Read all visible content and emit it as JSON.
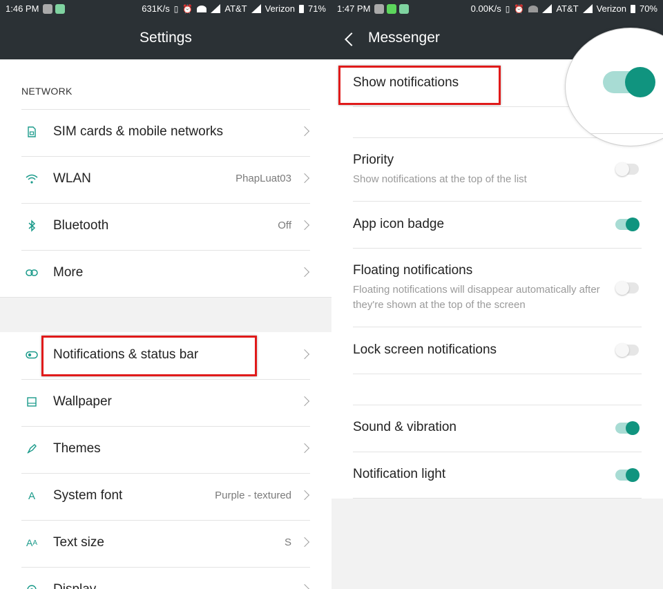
{
  "left": {
    "status": {
      "time": "1:46 PM",
      "speed": "631K/s",
      "carrier1": "AT&T",
      "carrier2": "Verizon",
      "battery": "71%"
    },
    "title": "Settings",
    "section_network": "NETWORK",
    "rows": [
      {
        "label": "SIM cards & mobile networks",
        "value": "",
        "icon": "sim-card-icon"
      },
      {
        "label": "WLAN",
        "value": "PhapLuat03",
        "icon": "wifi-icon"
      },
      {
        "label": "Bluetooth",
        "value": "Off",
        "icon": "bluetooth-icon"
      },
      {
        "label": "More",
        "value": "",
        "icon": "link-icon"
      },
      {
        "label": "Notifications & status bar",
        "value": "",
        "icon": "toggle-icon"
      },
      {
        "label": "Wallpaper",
        "value": "",
        "icon": "wallpaper-icon"
      },
      {
        "label": "Themes",
        "value": "",
        "icon": "brush-icon"
      },
      {
        "label": "System font",
        "value": "Purple - textured",
        "icon": "font-icon"
      },
      {
        "label": "Text size",
        "value": "S",
        "icon": "text-size-icon"
      },
      {
        "label": "Display",
        "value": "",
        "icon": "display-icon"
      }
    ]
  },
  "right": {
    "status": {
      "time": "1:47 PM",
      "speed": "0.00K/s",
      "carrier1": "AT&T",
      "carrier2": "Verizon",
      "battery": "70%"
    },
    "title": "Messenger",
    "show_notifications": {
      "label": "Show notifications",
      "on": true
    },
    "settings": [
      {
        "label": "Priority",
        "sub": "Show notifications at the top of the list",
        "on": false
      },
      {
        "label": "App icon badge",
        "sub": "",
        "on": true
      },
      {
        "label": "Floating notifications",
        "sub": "Floating notifications will disappear automatically after they're shown at the top of the screen",
        "on": false
      },
      {
        "label": "Lock screen notifications",
        "sub": "",
        "on": false
      },
      {
        "label": "Sound & vibration",
        "sub": "",
        "on": true
      },
      {
        "label": "Notification light",
        "sub": "",
        "on": true
      }
    ]
  },
  "colors": {
    "accent": "#10947f",
    "highlight": "#e01a1a",
    "header": "#2b3135"
  }
}
